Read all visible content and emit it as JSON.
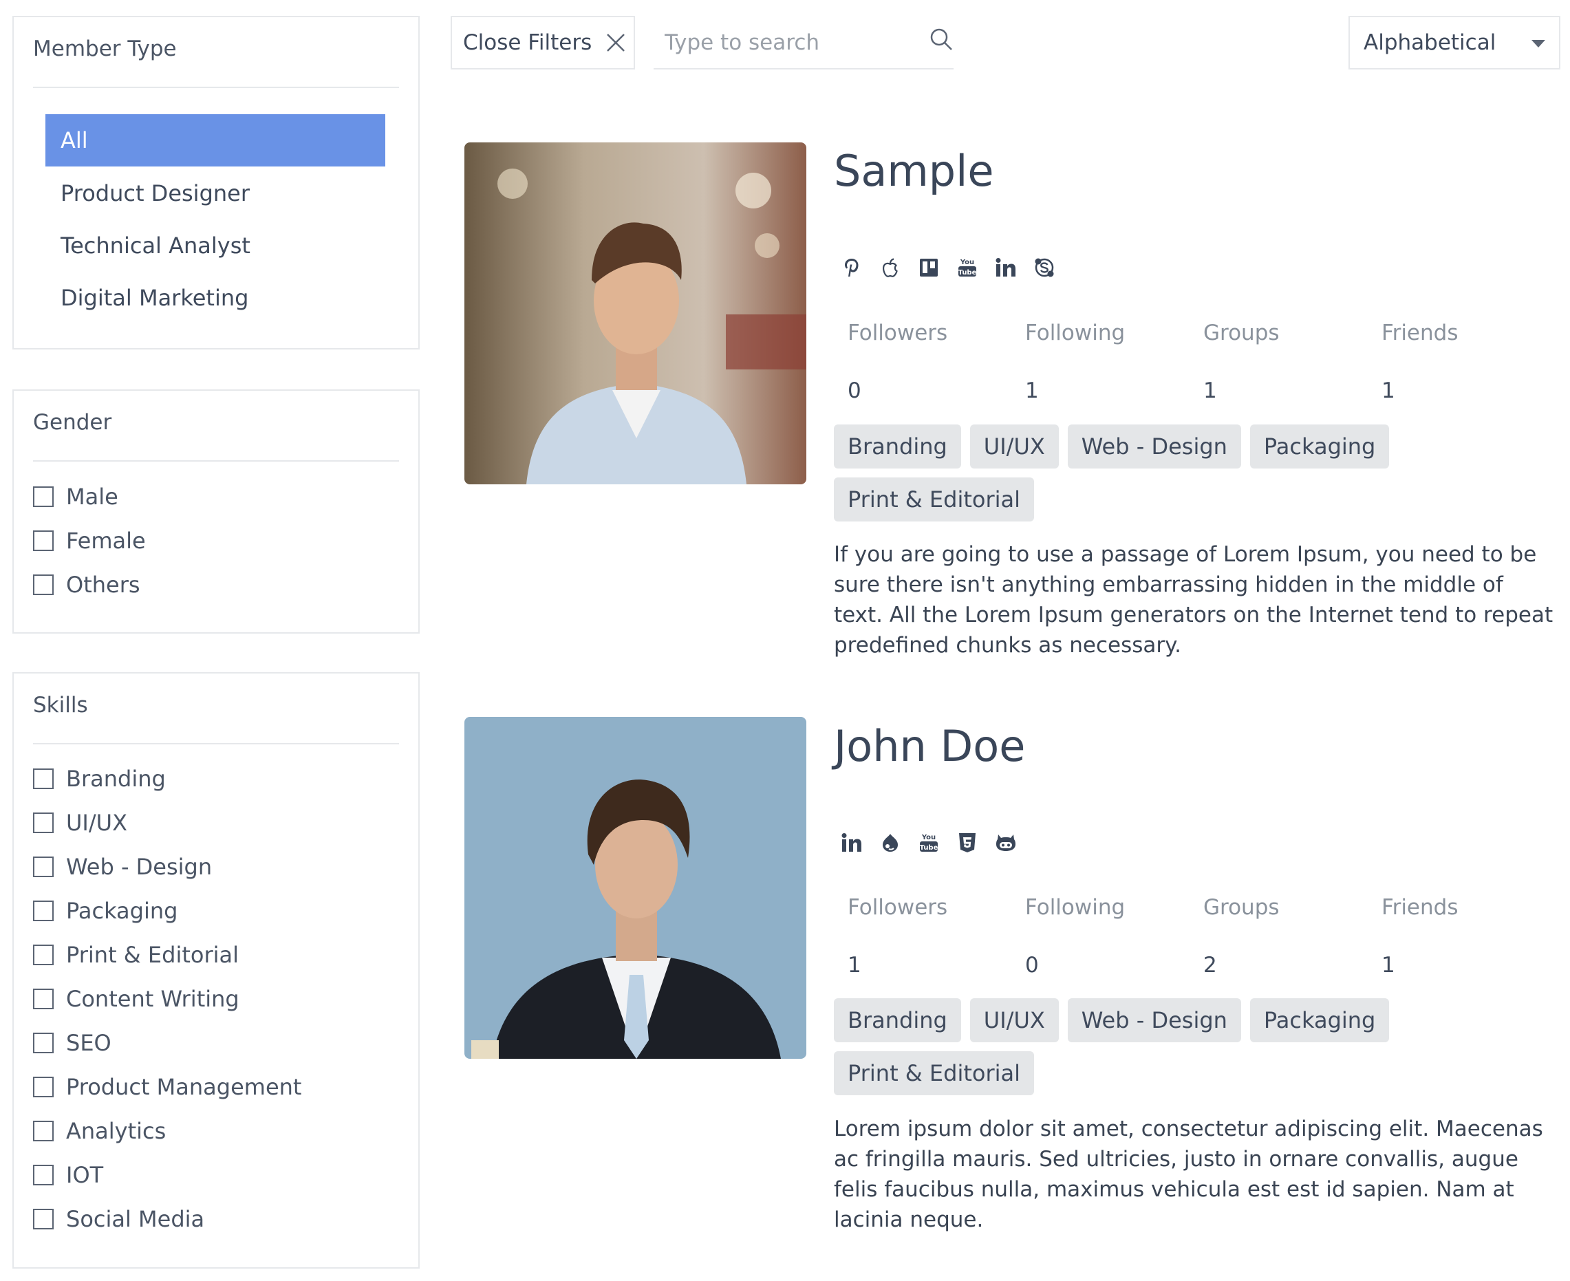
{
  "filters": {
    "member_type": {
      "title": "Member Type",
      "items": [
        "All",
        "Product Designer",
        "Technical Analyst",
        "Digital Marketing"
      ],
      "active_index": 0
    },
    "gender": {
      "title": "Gender",
      "options": [
        "Male",
        "Female",
        "Others"
      ]
    },
    "skills": {
      "title": "Skills",
      "options": [
        "Branding",
        "UI/UX",
        "Web - Design",
        "Packaging",
        "Print & Editorial",
        "Content Writing",
        "SEO",
        "Product Management",
        "Analytics",
        "IOT",
        "Social Media"
      ]
    }
  },
  "toolbar": {
    "close_filters_label": "Close Filters",
    "search_placeholder": "Type to search",
    "sort_selected": "Alphabetical"
  },
  "colors": {
    "accent": "#6992e6",
    "tag_bg": "#e4e6e8",
    "text": "#3f4a5c",
    "muted": "#8a929c",
    "border": "#e6e8eb"
  },
  "members": [
    {
      "name": "Sample",
      "socials": [
        "pinterest-icon",
        "apple-icon",
        "trello-icon",
        "youtube-icon",
        "linkedin-icon",
        "skype-icon"
      ],
      "stat_labels": [
        "Followers",
        "Following",
        "Groups",
        "Friends"
      ],
      "stat_values": [
        "0",
        "1",
        "1",
        "1"
      ],
      "tags": [
        "Branding",
        "UI/UX",
        "Web - Design",
        "Packaging",
        "Print & Editorial"
      ],
      "bio": "If you are going to use a passage of Lorem Ipsum, you need to be sure there isn't anything embarrassing hidden in the middle of text. All the Lorem Ipsum generators on the Internet tend to repeat predefined chunks as necessary."
    },
    {
      "name": "John Doe",
      "socials": [
        "linkedin-icon",
        "drupal-icon",
        "youtube-icon",
        "html5-icon",
        "github-icon"
      ],
      "stat_labels": [
        "Followers",
        "Following",
        "Groups",
        "Friends"
      ],
      "stat_values": [
        "1",
        "0",
        "2",
        "1"
      ],
      "tags": [
        "Branding",
        "UI/UX",
        "Web - Design",
        "Packaging",
        "Print & Editorial"
      ],
      "bio": "Lorem ipsum dolor sit amet, consectetur adipiscing elit. Maecenas ac fringilla mauris. Sed ultricies, justo in ornare convallis, augue felis faucibus nulla, maximus vehicula est est id sapien. Nam at lacinia neque."
    }
  ]
}
